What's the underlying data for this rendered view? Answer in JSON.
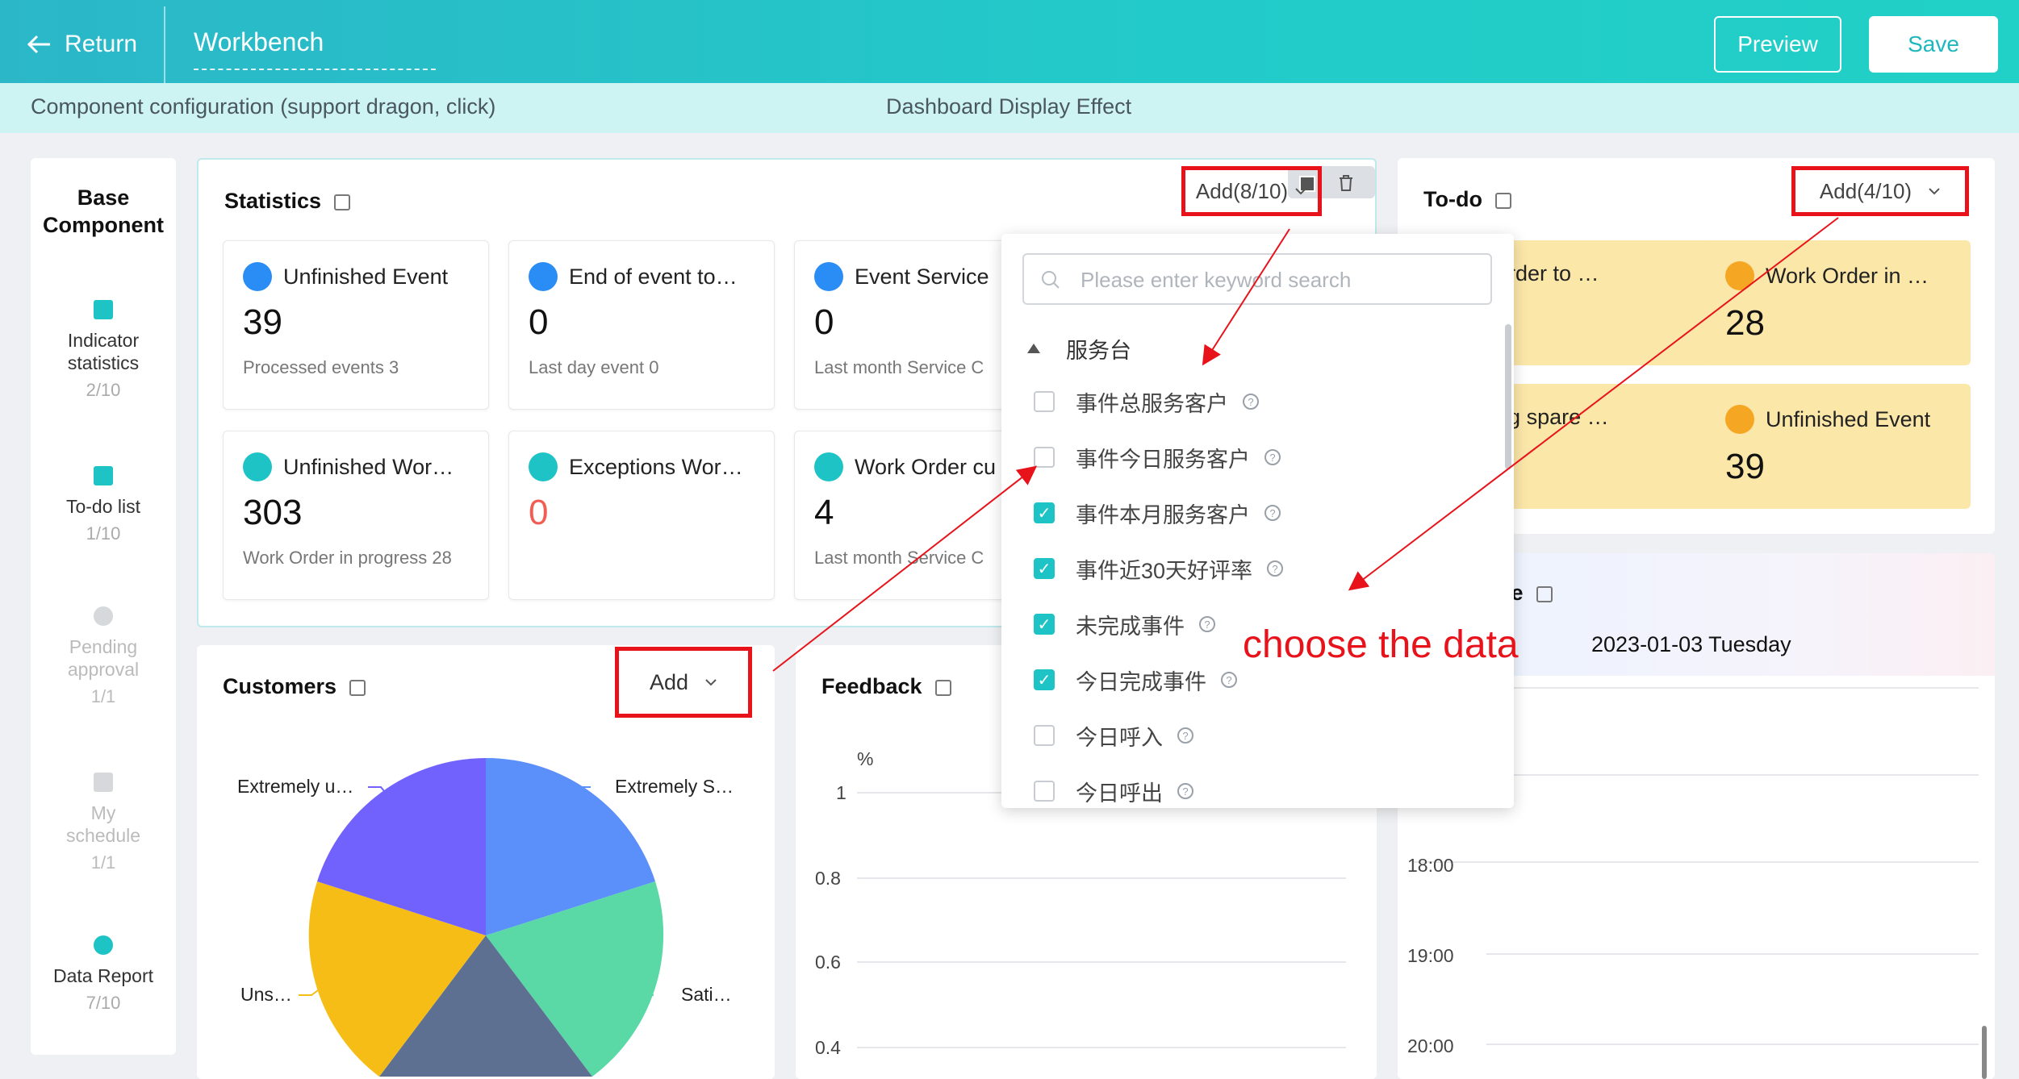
{
  "topbar": {
    "return_label": "Return",
    "title": "Workbench",
    "preview_label": "Preview",
    "save_label": "Save"
  },
  "subbar": {
    "left": "Component configuration (support dragon, click)",
    "right": "Dashboard Display Effect"
  },
  "sidebar": {
    "title": "Base Component",
    "items": [
      {
        "label": "Indicator statistics",
        "count": "2/10",
        "icon": "chart-icon"
      },
      {
        "label": "To-do list",
        "count": "1/10",
        "icon": "calendar-check-icon"
      },
      {
        "label": "Pending approval",
        "count": "1/1",
        "icon": "user-icon"
      },
      {
        "label": "My schedule",
        "count": "1/1",
        "icon": "calendar-icon"
      },
      {
        "label": "Data Report",
        "count": "7/10",
        "icon": "pie-icon"
      }
    ]
  },
  "statistics": {
    "title": "Statistics",
    "add_label": "Add(8/10)",
    "cards": [
      {
        "title": "Unfinished Event",
        "value": "39",
        "sub": "Processed events  3"
      },
      {
        "title": "End of event to…",
        "value": "0",
        "sub": "Last day event  0"
      },
      {
        "title": "Event Service",
        "value": "0",
        "sub": "Last month Service C"
      },
      {
        "title": "Unfinished Wor…",
        "value": "303",
        "sub": "Work Order in progress  28"
      },
      {
        "title": "Exceptions Wor…",
        "value": "0",
        "sub": ""
      },
      {
        "title": "Work Order cu",
        "value": "4",
        "sub": "Last month Service C"
      }
    ]
  },
  "todo": {
    "title": "To-do",
    "add_label": "Add(4/10)",
    "cards": [
      {
        "title": "rk Order to …",
        "value": ""
      },
      {
        "title": "Work Order in …",
        "value": "28"
      },
      {
        "title": "nding spare …",
        "value": ""
      },
      {
        "title": "Unfinished Event",
        "value": "39"
      }
    ]
  },
  "dropdown": {
    "search_placeholder": "Please enter keyword search",
    "group": "服务台",
    "options": [
      {
        "label": "事件总服务客户",
        "checked": false
      },
      {
        "label": "事件今日服务客户",
        "checked": false
      },
      {
        "label": "事件本月服务客户",
        "checked": true
      },
      {
        "label": "事件近30天好评率",
        "checked": true
      },
      {
        "label": "未完成事件",
        "checked": true
      },
      {
        "label": "今日完成事件",
        "checked": true
      },
      {
        "label": "今日呼入",
        "checked": false
      },
      {
        "label": "今日呼出",
        "checked": false
      }
    ]
  },
  "annotation": {
    "text": "choose the data",
    "color": "#e8131a"
  },
  "customers": {
    "title": "Customers",
    "add_label": "Add",
    "labels": [
      "Extremely u…",
      "Extremely S…",
      "Uns…",
      "Sati…"
    ]
  },
  "feedback": {
    "title": "Feedback",
    "unit": "%",
    "ticks": [
      "1",
      "0.8",
      "0.6",
      "0.4"
    ]
  },
  "schedule": {
    "title": "dule",
    "date": "2023-01-03 Tuesday",
    "times": [
      "18:00",
      "19:00",
      "20:00"
    ]
  },
  "colors": {
    "accent": "#1ec3c6",
    "red": "#e8131a",
    "pie_blue": "#5b8ff9",
    "pie_green": "#5ad8a6",
    "pie_slate": "#5d7092",
    "pie_yellow": "#f6bd16",
    "pie_purple": "#7262fd"
  }
}
